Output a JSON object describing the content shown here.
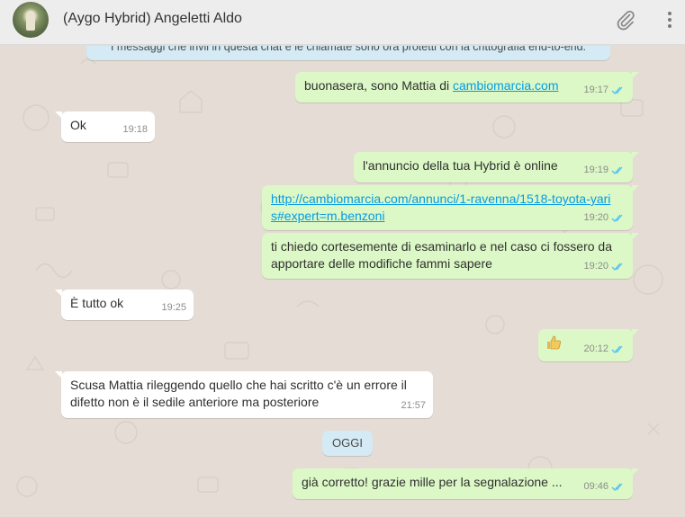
{
  "header": {
    "contact_name": "(Aygo Hybrid) Angeletti Aldo",
    "attach_icon": "paperclip-icon",
    "menu_icon": "kebab-menu-icon"
  },
  "chat": {
    "encryption_notice": "I messaggi che invii in questa chat e le chiamate sono ora protetti con la crittografia end-to-end.",
    "day_separator": "OGGI",
    "messages": [
      {
        "direction": "out",
        "text_before": "buonasera, sono Mattia di ",
        "link": "cambiomarcia.com",
        "time": "19:17",
        "status": "read"
      },
      {
        "direction": "in",
        "text": "Ok",
        "time": "19:18"
      },
      {
        "direction": "out",
        "text": "l'annuncio della tua Hybrid è online",
        "time": "19:19",
        "status": "read"
      },
      {
        "direction": "out",
        "link": "http://cambiomarcia.com/annunci/1-ravenna/1518-toyota-yaris#expert=m.benzoni",
        "time": "19:20",
        "status": "read"
      },
      {
        "direction": "out",
        "text": "ti chiedo cortesemente di esaminarlo e nel caso ci fossero da apportare delle modifiche fammi sapere",
        "time": "19:20",
        "status": "read"
      },
      {
        "direction": "in",
        "text": "È tutto ok",
        "time": "19:25"
      },
      {
        "direction": "out",
        "icon": "thumbs-up-emoji",
        "time": "20:12",
        "status": "read"
      },
      {
        "direction": "in",
        "text": "Scusa Mattia rileggendo quello che hai scritto c'è un errore il difetto non è il sedile anteriore ma posteriore",
        "time": "21:57"
      },
      {
        "direction": "out",
        "text": "già corretto! grazie mille per la segnalazione ...",
        "time": "09:46",
        "status": "read"
      }
    ]
  },
  "colors": {
    "chat_background": "#e5ddd5",
    "outgoing_bubble": "#dcf8c6",
    "incoming_bubble": "#ffffff",
    "system_bubble": "#d4eaf4",
    "link": "#039be5",
    "read_ticks": "#4fc3f7"
  }
}
